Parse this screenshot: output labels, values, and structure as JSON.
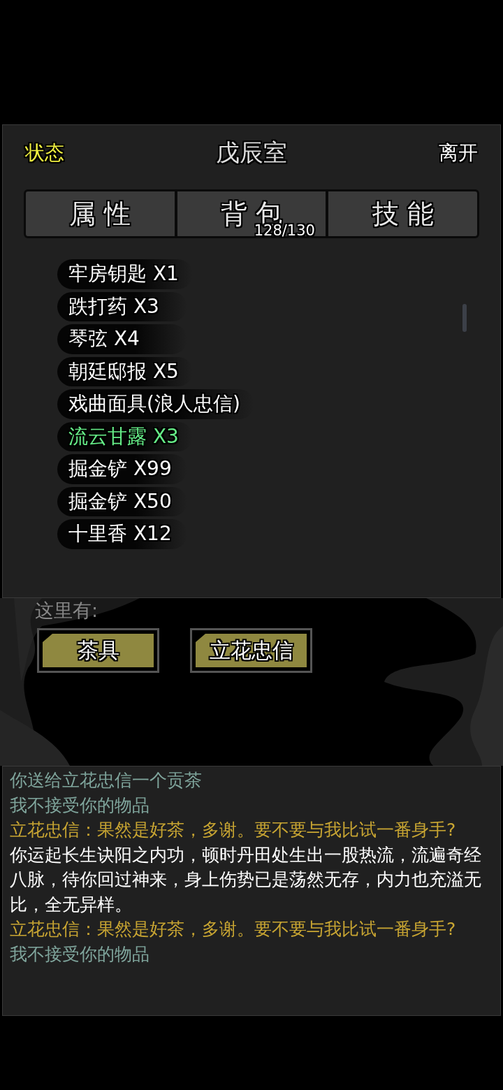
{
  "header": {
    "status_link": "状态",
    "title": "戊辰室",
    "leave_link": "离开"
  },
  "tabs": [
    {
      "label": "属 性"
    },
    {
      "label": "背 包",
      "count": "128/130"
    },
    {
      "label": "技 能"
    }
  ],
  "inventory": [
    {
      "label": "牢房钥匙 X1",
      "color": "#ffffff"
    },
    {
      "label": "跌打药 X3",
      "color": "#ffffff"
    },
    {
      "label": "琴弦 X4",
      "color": "#ffffff"
    },
    {
      "label": "朝廷邸报 X5",
      "color": "#ffffff"
    },
    {
      "label": "戏曲面具(浪人忠信)",
      "color": "#ffffff"
    },
    {
      "label": "流云甘露 X3",
      "color": "#66ee88"
    },
    {
      "label": "掘金铲 X99",
      "color": "#ffffff"
    },
    {
      "label": "掘金铲 X50",
      "color": "#ffffff"
    },
    {
      "label": "十里香 X12",
      "color": "#ffffff"
    }
  ],
  "here": {
    "label": "这里有:",
    "buttons": [
      "茶具",
      "立花忠信"
    ]
  },
  "log": [
    {
      "text": "你送给立花忠信一个贡茶",
      "color": "#7fa59c"
    },
    {
      "text": "我不接受你的物品",
      "color": "#7fa59c"
    },
    {
      "text": "立花忠信：果然是好茶，多谢。要不要与我比试一番身手?",
      "color": "#c8a532"
    },
    {
      "text": "你运起长生诀阳之内功，顿时丹田处生出一股热流，流遍奇经八脉，待你回过神来，身上伤势已是荡然无存，内力也充溢无比，全无异样。",
      "color": "#ffffff"
    },
    {
      "text": "立花忠信：果然是好茶，多谢。要不要与我比试一番身手?",
      "color": "#c8a532"
    },
    {
      "text": "我不接受你的物品",
      "color": "#7fa59c"
    }
  ]
}
